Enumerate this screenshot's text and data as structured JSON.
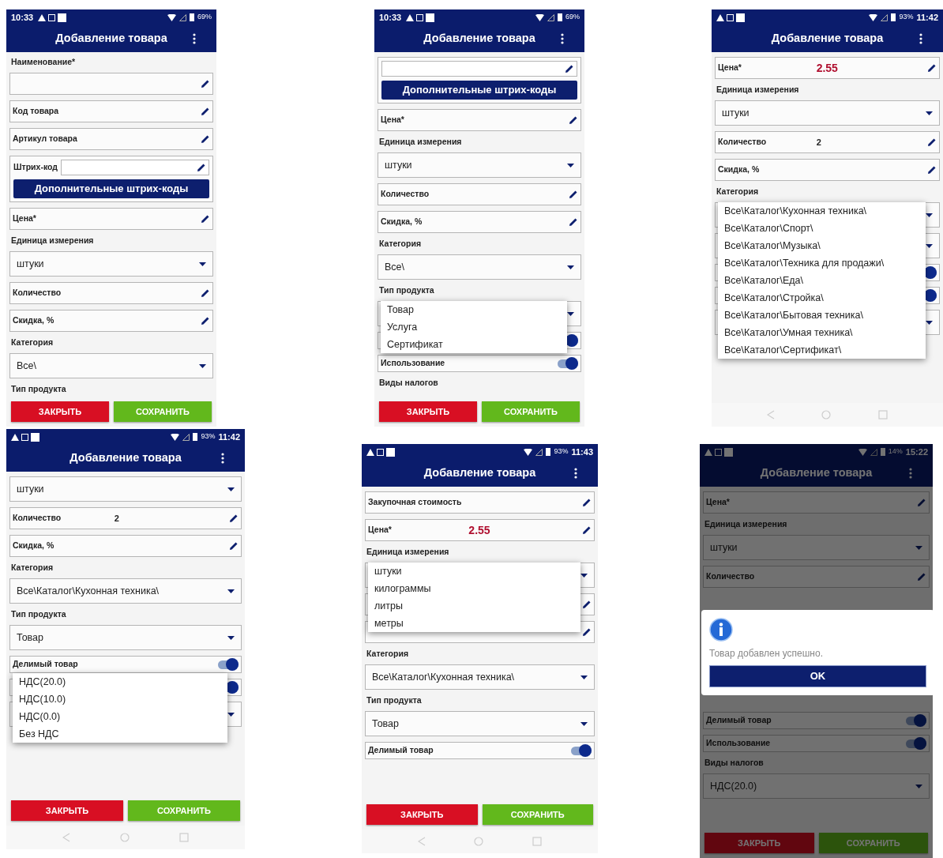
{
  "phones": [
    {
      "status": {
        "kind": "left-clock",
        "time": "10:33",
        "battery": "69%"
      },
      "title": "Добавление товара",
      "dimmed": false,
      "nav_bar": false,
      "rows": [
        {
          "kind": "label",
          "text": "Наименование*"
        },
        {
          "kind": "field"
        },
        {
          "kind": "field",
          "label": "Код товара"
        },
        {
          "kind": "field",
          "label": "Артикул товара"
        },
        {
          "kind": "barcode",
          "label": "Штрих-код",
          "button": "Дополнительные штрих-коды"
        },
        {
          "kind": "field",
          "label": "Цена*"
        },
        {
          "kind": "label",
          "text": "Единица измерения"
        },
        {
          "kind": "dropdown",
          "value": "штуки"
        },
        {
          "kind": "field",
          "label": "Количество"
        },
        {
          "kind": "field",
          "label": "Скидка, %"
        },
        {
          "kind": "label",
          "text": "Категория"
        },
        {
          "kind": "dropdown",
          "value": "Все\\"
        },
        {
          "kind": "label",
          "text": "Тип продукта"
        }
      ],
      "buttons": [
        {
          "kind": "close",
          "label": "ЗАКРЫТЬ"
        },
        {
          "kind": "save",
          "label": "СОХРАНИТЬ"
        }
      ]
    },
    {
      "status": {
        "kind": "left-clock",
        "time": "10:33",
        "battery": "69%"
      },
      "title": "Добавление товара",
      "dimmed": false,
      "nav_bar": false,
      "rows": [
        {
          "kind": "barcode",
          "button": "Дополнительные штрих-коды"
        },
        {
          "kind": "field",
          "label": "Цена*"
        },
        {
          "kind": "label",
          "text": "Единица измерения"
        },
        {
          "kind": "dropdown",
          "value": "штуки"
        },
        {
          "kind": "field",
          "label": "Количество"
        },
        {
          "kind": "field",
          "label": "Скидка, %"
        },
        {
          "kind": "label",
          "text": "Категория"
        },
        {
          "kind": "dropdown",
          "value": "Все\\"
        },
        {
          "kind": "label",
          "text": "Тип продукта"
        },
        {
          "kind": "dropdown",
          "menu": [
            "Товар",
            "Услуга",
            "Сертификат"
          ]
        },
        {
          "kind": "toggle",
          "on": true
        },
        {
          "kind": "toggle",
          "label": "Использование",
          "on": true
        },
        {
          "kind": "label",
          "text": "Виды налогов"
        }
      ],
      "buttons": [
        {
          "kind": "close",
          "label": "ЗАКРЫТЬ"
        },
        {
          "kind": "save",
          "label": "СОХРАНИТЬ"
        }
      ]
    },
    {
      "status": {
        "kind": "right-clock",
        "time": "11:42",
        "battery": "93%"
      },
      "title": "Добавление товара",
      "dimmed": false,
      "nav_bar": true,
      "rows": [
        {
          "kind": "field",
          "label": "Цена*",
          "value": "2.55",
          "accent": true
        },
        {
          "kind": "label",
          "text": "Единица измерения"
        },
        {
          "kind": "dropdown",
          "value": "штуки"
        },
        {
          "kind": "field",
          "label": "Количество",
          "value": "2",
          "accent": false
        },
        {
          "kind": "field",
          "label": "Скидка, %"
        },
        {
          "kind": "label",
          "text": "Категория"
        },
        {
          "kind": "dropdown",
          "menu": [
            "Все\\Каталог\\Кухонная техника\\",
            "Все\\Каталог\\Спорт\\",
            "Все\\Каталог\\Музыка\\",
            "Все\\Каталог\\Техника для продажи\\",
            "Все\\Каталог\\Еда\\",
            "Все\\Каталог\\Стройка\\",
            "Все\\Каталог\\Бытовая техника\\",
            "Все\\Каталог\\Умная техника\\",
            "Все\\Каталог\\Сертификат\\"
          ]
        },
        {
          "kind": "dropdown"
        },
        {
          "kind": "toggle",
          "on": true
        },
        {
          "kind": "toggle",
          "on": true
        },
        {
          "kind": "dropdown"
        }
      ]
    },
    {
      "status": {
        "kind": "right-clock",
        "time": "11:42",
        "battery": "93%"
      },
      "title": "Добавление товара",
      "dimmed": false,
      "nav_bar": true,
      "rows": [
        {
          "kind": "dropdown",
          "value": "штуки"
        },
        {
          "kind": "field",
          "label": "Количество",
          "value": "2",
          "accent": false
        },
        {
          "kind": "field",
          "label": "Скидка, %"
        },
        {
          "kind": "label",
          "text": "Категория"
        },
        {
          "kind": "dropdown",
          "value": "Все\\Каталог\\Кухонная техника\\"
        },
        {
          "kind": "label",
          "text": "Тип продукта"
        },
        {
          "kind": "dropdown",
          "value": "Товар"
        },
        {
          "kind": "toggle",
          "label": "Делимый товар",
          "on": true,
          "menu": [
            "НДС(20.0)",
            "НДС(10.0)",
            "НДС(0.0)",
            "Без НДС"
          ]
        },
        {
          "kind": "toggle",
          "on": true
        },
        {
          "kind": "dropdown"
        }
      ],
      "buttons": [
        {
          "kind": "close",
          "label": "ЗАКРЫТЬ"
        },
        {
          "kind": "save",
          "label": "СОХРАНИТЬ"
        }
      ]
    },
    {
      "status": {
        "kind": "right-clock",
        "time": "11:43",
        "battery": "93%"
      },
      "title": "Добавление товара",
      "dimmed": false,
      "nav_bar": true,
      "rows": [
        {
          "kind": "field",
          "label": "Закупочная стоимость"
        },
        {
          "kind": "field",
          "label": "Цена*",
          "value": "2.55",
          "accent": true
        },
        {
          "kind": "label",
          "text": "Единица измерения"
        },
        {
          "kind": "dropdown",
          "menu": [
            "штуки",
            "килограммы",
            "литры",
            "метры"
          ]
        },
        {
          "kind": "field"
        },
        {
          "kind": "field"
        },
        {
          "kind": "label",
          "text": "Категория"
        },
        {
          "kind": "dropdown",
          "value": "Все\\Каталог\\Кухонная техника\\"
        },
        {
          "kind": "label",
          "text": "Тип продукта"
        },
        {
          "kind": "dropdown",
          "value": "Товар"
        },
        {
          "kind": "toggle",
          "label": "Делимый товар",
          "on": true
        }
      ],
      "buttons": [
        {
          "kind": "close",
          "label": "ЗАКРЫТЬ"
        },
        {
          "kind": "save",
          "label": "СОХРАНИТЬ"
        }
      ]
    },
    {
      "status": {
        "kind": "right-clock",
        "time": "15:22",
        "battery": "14%"
      },
      "title": "Добавление товара",
      "dimmed": true,
      "nav_bar": false,
      "rows": [
        {
          "kind": "field",
          "label": "Цена*"
        },
        {
          "kind": "label",
          "text": "Единица измерения"
        },
        {
          "kind": "dropdown",
          "value": "штуки"
        },
        {
          "kind": "field",
          "label": "Количество",
          "dialog": {
            "message": "Товар добавлен успешно.",
            "button": "OK"
          }
        },
        {
          "kind": "toggle",
          "label": "Делимый товар",
          "on": true
        },
        {
          "kind": "toggle",
          "label": "Использование",
          "on": true
        },
        {
          "kind": "label",
          "text": "Виды налогов"
        },
        {
          "kind": "dropdown",
          "value": "НДС(20.0)"
        }
      ],
      "buttons": [
        {
          "kind": "close",
          "label": "ЗАКРЫТЬ"
        },
        {
          "kind": "save",
          "label": "СОХРАНИТЬ"
        }
      ]
    }
  ]
}
